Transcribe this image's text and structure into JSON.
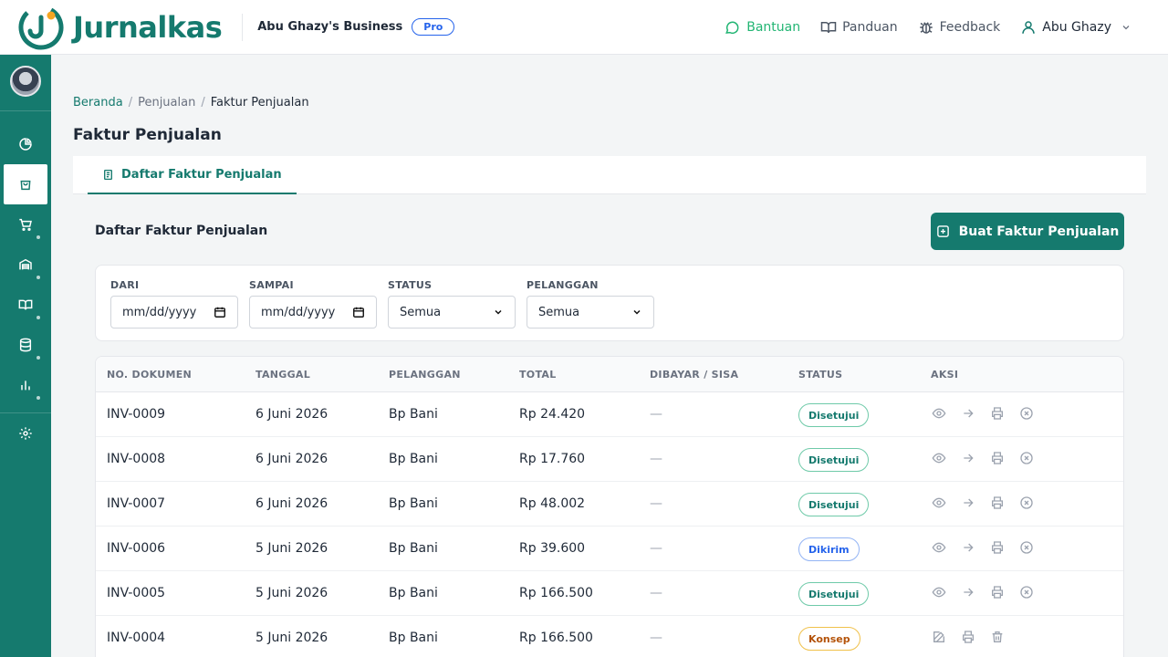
{
  "app": {
    "name": "Jurnalkas",
    "business": "Abu Ghazy's Business",
    "plan": "Pro"
  },
  "topnav": {
    "help": "Bantuan",
    "guide": "Panduan",
    "feedback": "Feedback",
    "user": "Abu Ghazy"
  },
  "breadcrumb": {
    "home": "Beranda",
    "section": "Penjualan",
    "current": "Faktur Penjualan"
  },
  "page": {
    "title": "Faktur Penjualan",
    "tab": "Daftar Faktur Penjualan",
    "list_title": "Daftar Faktur Penjualan",
    "create_button": "Buat Faktur Penjualan"
  },
  "filters": {
    "from_label": "DARI",
    "from_value": "mm/dd/yyyy",
    "to_label": "SAMPAI",
    "to_value": "mm/dd/yyyy",
    "status_label": "STATUS",
    "status_value": "Semua",
    "customer_label": "PELANGGAN",
    "customer_value": "Semua"
  },
  "table": {
    "headers": {
      "doc": "NO. DOKUMEN",
      "date": "TANGGAL",
      "customer": "PELANGGAN",
      "total": "TOTAL",
      "paid": "DIBAYAR / SISA",
      "status": "STATUS",
      "action": "AKSI"
    },
    "rows": [
      {
        "doc": "INV-0009",
        "date": "6 Juni 2026",
        "customer": "Bp Bani",
        "total": "Rp 24.420",
        "paid": "—",
        "status": "Disetujui"
      },
      {
        "doc": "INV-0008",
        "date": "6 Juni 2026",
        "customer": "Bp Bani",
        "total": "Rp 17.760",
        "paid": "—",
        "status": "Disetujui"
      },
      {
        "doc": "INV-0007",
        "date": "6 Juni 2026",
        "customer": "Bp Bani",
        "total": "Rp 48.002",
        "paid": "—",
        "status": "Disetujui"
      },
      {
        "doc": "INV-0006",
        "date": "5 Juni 2026",
        "customer": "Bp Bani",
        "total": "Rp 39.600",
        "paid": "—",
        "status": "Dikirim"
      },
      {
        "doc": "INV-0005",
        "date": "5 Juni 2026",
        "customer": "Bp Bani",
        "total": "Rp 166.500",
        "paid": "—",
        "status": "Disetujui"
      },
      {
        "doc": "INV-0004",
        "date": "5 Juni 2026",
        "customer": "Bp Bani",
        "total": "Rp 166.500",
        "paid": "—",
        "status": "Konsep"
      }
    ]
  },
  "colors": {
    "brand": "#157a6e",
    "help": "#22b573",
    "approved": "#157a6e",
    "sent": "#2563eb",
    "draft": "#b45309"
  }
}
